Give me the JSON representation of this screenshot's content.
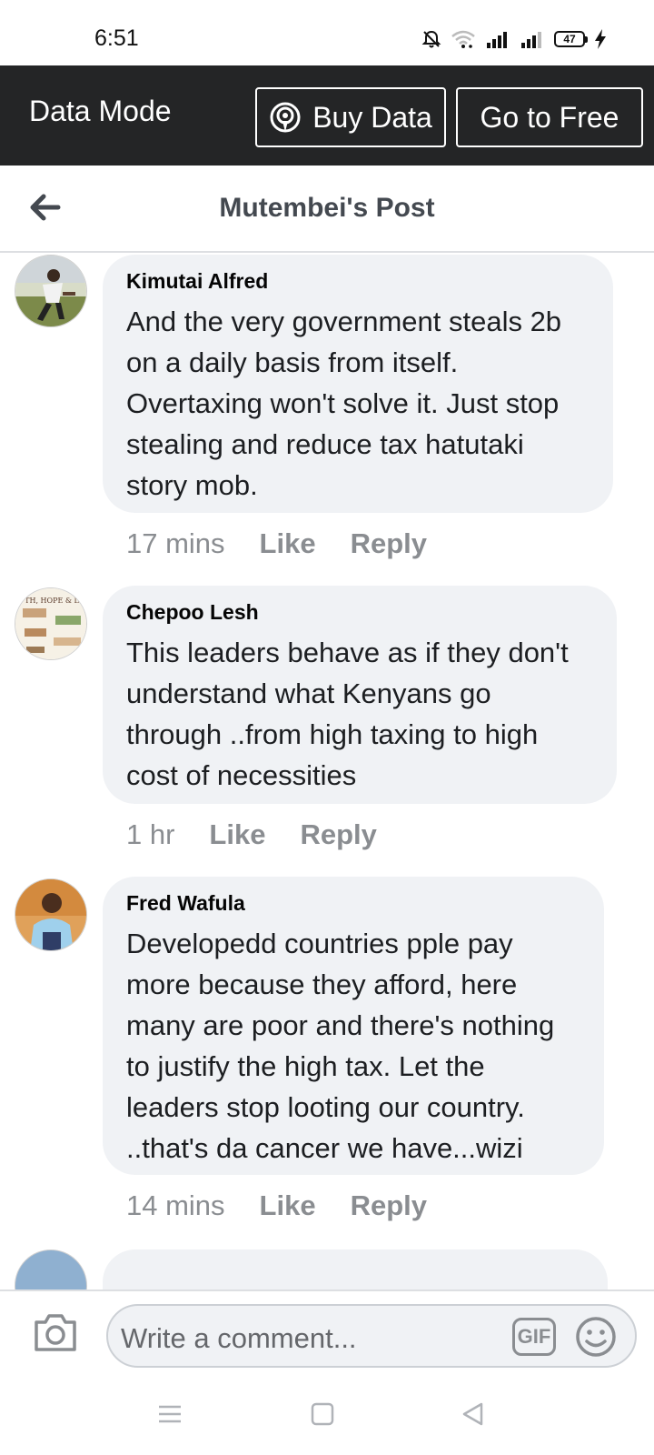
{
  "status_bar": {
    "time": "6:51",
    "battery": "47"
  },
  "data_bar": {
    "mode_label": "Data Mode",
    "buy_data_label": "Buy Data",
    "go_free_label": "Go to Free"
  },
  "header": {
    "title": "Mutembei's Post"
  },
  "comments": [
    {
      "author": "Kimutai Alfred",
      "text": "And the very government steals 2b on a daily basis from itself. Overtaxing won't solve it. Just stop stealing and reduce tax hatutaki story mob.",
      "time": "17 mins",
      "like_label": "Like",
      "reply_label": "Reply"
    },
    {
      "author": "Chepoo Lesh",
      "text": "This leaders behave as if they don't understand what Kenyans go through ..from high taxing to high cost of necessities",
      "time": "1 hr",
      "like_label": "Like",
      "reply_label": "Reply"
    },
    {
      "author": "Fred Wafula",
      "text": "Developedd countries pple pay more because they afford, here many are poor and there's nothing to justify the high tax. Let the leaders stop looting our country. ..that's da cancer we have...wizi",
      "time": "14 mins",
      "like_label": "Like",
      "reply_label": "Reply"
    }
  ],
  "composer": {
    "placeholder": "Write a comment...",
    "gif_label": "GIF"
  },
  "icons": {
    "back": "back-arrow-icon",
    "camera": "camera-icon",
    "emoji": "smiley-icon",
    "broadcast": "broadcast-icon"
  },
  "colors": {
    "data_bar_bg": "#242526",
    "bubble_bg": "#f0f2f5",
    "meta_text": "#8a8d91"
  }
}
